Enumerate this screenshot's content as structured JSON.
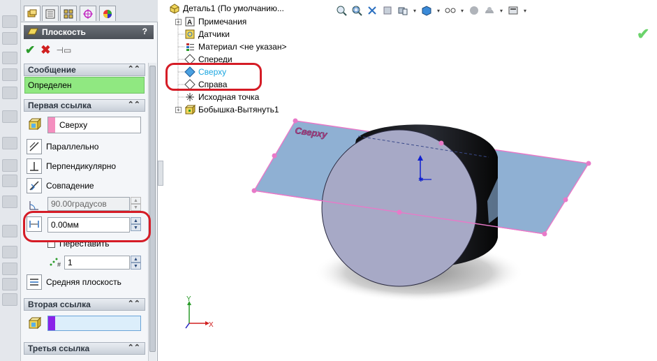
{
  "panel": {
    "title": "Плоскость",
    "help": "?",
    "sections": {
      "message": {
        "header": "Сообщение",
        "text": "Определен"
      },
      "first_ref": {
        "header": "Первая ссылка",
        "selection": "Сверху",
        "options": [
          "Параллельно",
          "Перпендикулярно",
          "Совпадение"
        ],
        "angle_value": "90.00градусов",
        "distance_value": "0.00мм",
        "flip_label": "Переставить",
        "count_value": "1",
        "midplane_label": "Средняя плоскость"
      },
      "second_ref": {
        "header": "Вторая ссылка",
        "selection": ""
      },
      "third_ref": {
        "header": "Третья ссылка"
      }
    },
    "collapse_glyph": "⌃⌃"
  },
  "tree": {
    "root": "Деталь1  (По умолчанию...",
    "items": [
      "Примечания",
      "Датчики",
      "Материал <не указан>",
      "Спереди",
      "Сверху",
      "Справа",
      "Исходная точка",
      "Бобышка-Вытянуть1"
    ]
  },
  "viewport": {
    "plane_label": "Сверху",
    "triad": {
      "x": "X",
      "y": "Y"
    }
  },
  "colors": {
    "highlight_text": "#1aa6e0",
    "annotation_red": "#d51c26",
    "plane_fill": "#8fb0d3",
    "cylinder_face": "#a7a9c6",
    "message_green": "#90e881",
    "plane_edge": "#e879c8"
  }
}
